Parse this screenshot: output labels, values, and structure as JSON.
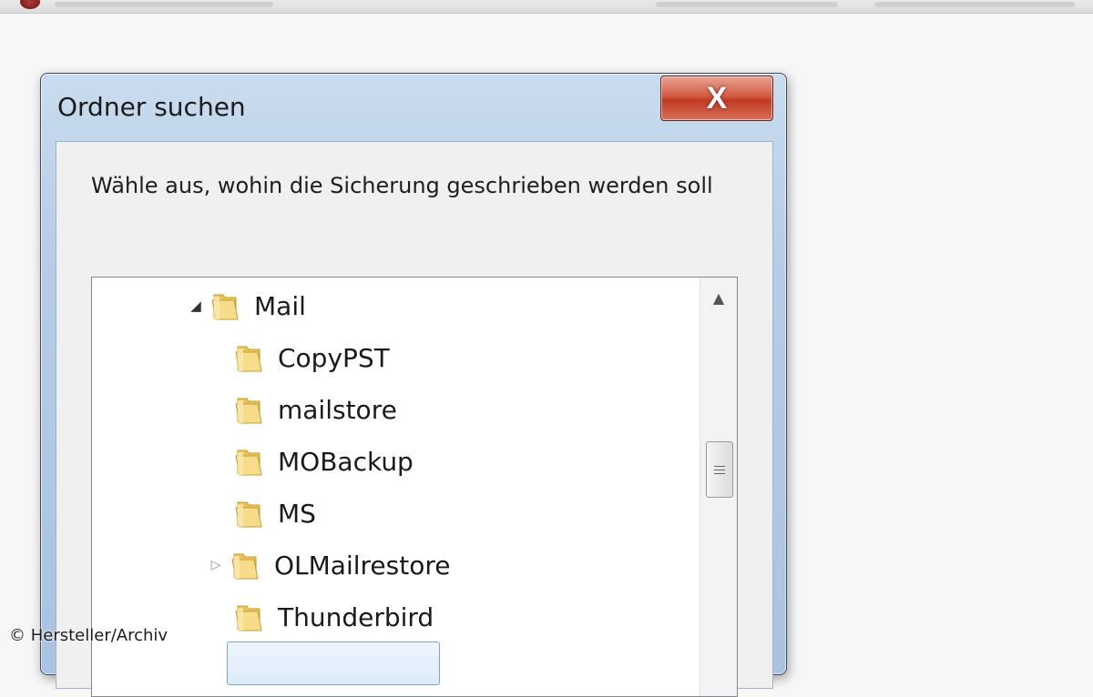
{
  "dialog": {
    "title": "Ordner suchen",
    "close_glyph": "X",
    "prompt": "Wähle aus, wohin die Sicherung geschrieben werden soll"
  },
  "tree": {
    "items": [
      {
        "label": "Mail",
        "expander": "open",
        "icon": "folder-icon"
      },
      {
        "label": "CopyPST",
        "expander": "none",
        "icon": "folder-icon"
      },
      {
        "label": "mailstore",
        "expander": "none",
        "icon": "folder-icon"
      },
      {
        "label": "MOBackup",
        "expander": "none",
        "icon": "folder-icon"
      },
      {
        "label": "MS",
        "expander": "none",
        "icon": "folder-icon"
      },
      {
        "label": "OLMailrestore",
        "expander": "closed",
        "icon": "folder-icon"
      },
      {
        "label": "Thunderbird",
        "expander": "none",
        "icon": "folder-icon"
      }
    ]
  },
  "watermark": "© Hersteller/Archiv",
  "colors": {
    "close_button": "#c94a32",
    "selection": "#dcebfc"
  }
}
